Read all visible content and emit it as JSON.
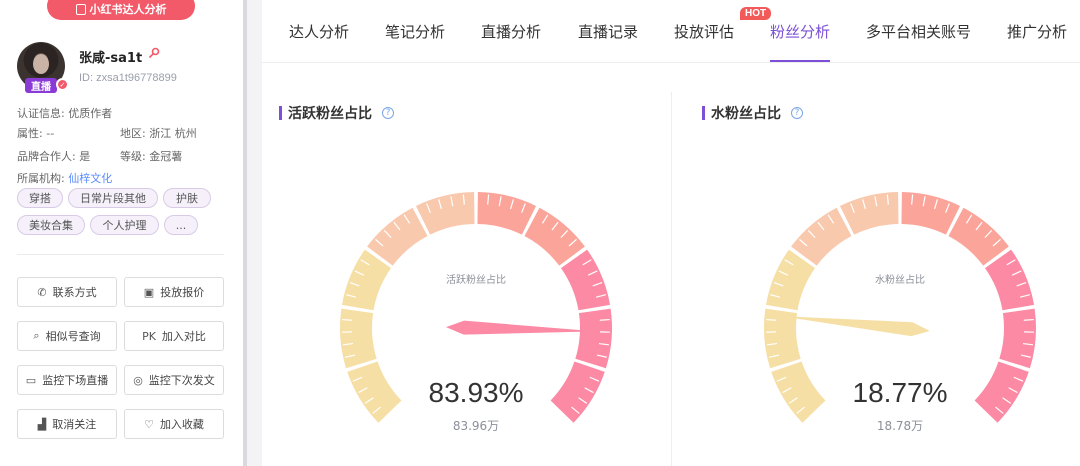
{
  "sidebar": {
    "top_button": "小红书达人分析",
    "live_badge": "直播",
    "name": "张咸-sa1t",
    "id_text": "ID: zxsa1t96778899",
    "cert_label": "认证信息:",
    "cert_value": "优质作者",
    "attr_label": "属性:",
    "attr_value": "--",
    "region_label": "地区:",
    "region_value": "浙江 杭州",
    "brand_label": "品牌合作人:",
    "brand_value": "是",
    "level_label": "等级:",
    "level_value": "金冠薯",
    "org_label": "所属机构:",
    "org_value": "仙梓文化",
    "tags": [
      "穿搭",
      "日常片段其他",
      "护肤",
      "美妆合集",
      "个人护理",
      "..."
    ],
    "actions": [
      {
        "label": "联系方式",
        "icon": "phone-icon",
        "glyph": "✆"
      },
      {
        "label": "投放报价",
        "icon": "price-icon",
        "glyph": "▣"
      },
      {
        "label": "相似号查询",
        "icon": "search-icon",
        "glyph": "⌕"
      },
      {
        "label": "加入对比",
        "icon": "pk-icon",
        "glyph": "PK"
      },
      {
        "label": "监控下场直播",
        "icon": "video-icon",
        "glyph": "▭"
      },
      {
        "label": "监控下次发文",
        "icon": "monitor-icon",
        "glyph": "◎"
      },
      {
        "label": "取消关注",
        "icon": "chart-icon",
        "glyph": "▟"
      },
      {
        "label": "加入收藏",
        "icon": "heart-icon",
        "glyph": "♡"
      }
    ]
  },
  "tabs": {
    "items": [
      "达人分析",
      "笔记分析",
      "直播分析",
      "直播记录",
      "投放评估",
      "粉丝分析",
      "多平台相关账号",
      "推广分析"
    ],
    "active_index": 5,
    "hot_badge": "HOT"
  },
  "cards": [
    {
      "title": "活跃粉丝占比",
      "gauge_label": "活跃粉丝占比",
      "value_text": "83.93%",
      "sub_text": "83.96万",
      "ratio": 0.8393
    },
    {
      "title": "水粉丝占比",
      "gauge_label": "水粉丝占比",
      "value_text": "18.77%",
      "sub_text": "18.78万",
      "ratio": 0.1877
    }
  ],
  "colors": {
    "accent": "#7b4fd6",
    "gauge_yellow": "#f6dfa5",
    "gauge_peach": "#f9c9ae",
    "gauge_salmon": "#fba49a",
    "gauge_pink": "#fc8aa4",
    "pointer_pink": "#fc8aa4",
    "pointer_yellow": "#f6dfa5"
  }
}
